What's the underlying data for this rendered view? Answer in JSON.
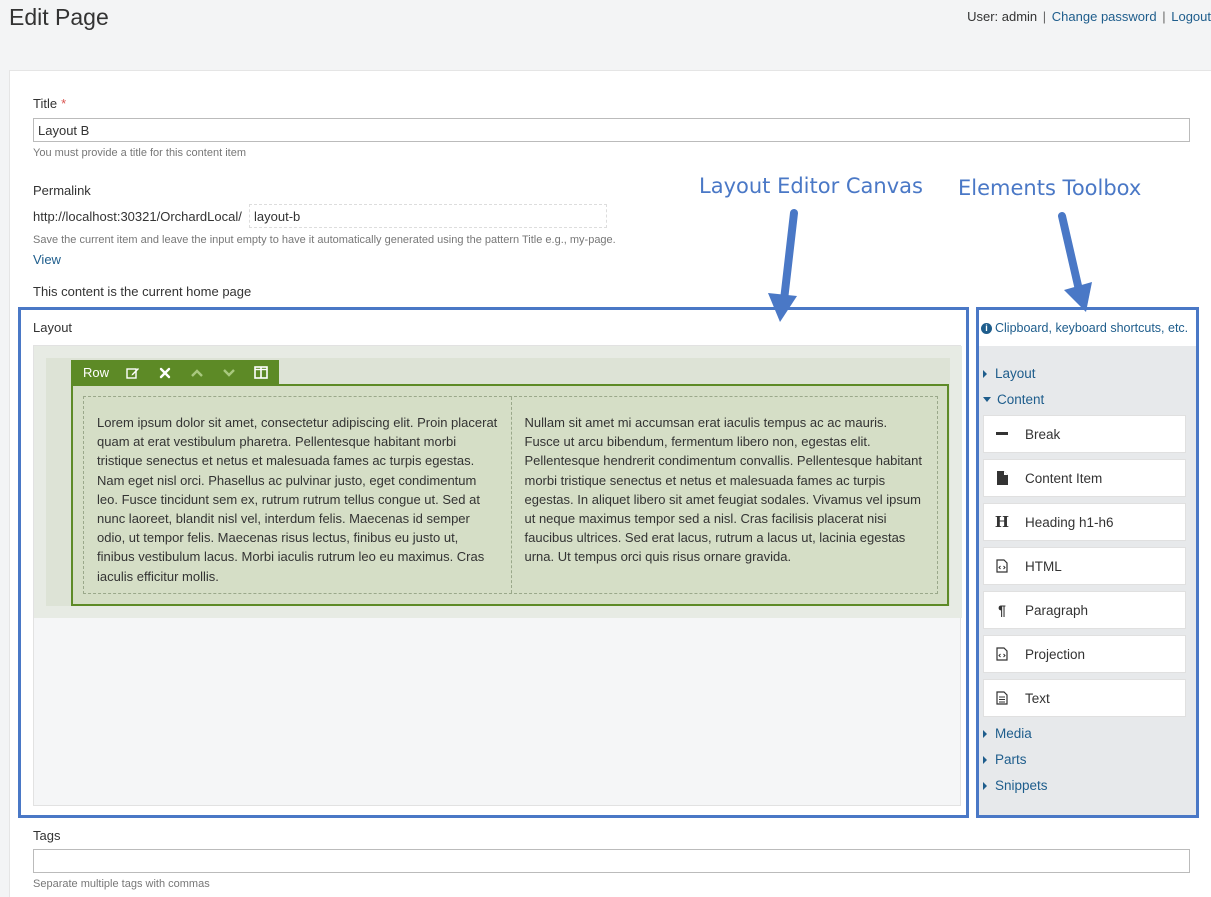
{
  "page": {
    "title": "Edit Page"
  },
  "user_bar": {
    "user_text": "User: admin",
    "sep": "|",
    "change_password": "Change password",
    "logout": "Logout"
  },
  "form": {
    "title_label": "Title",
    "required_mark": "*",
    "title_value": "Layout B",
    "title_hint": "You must provide a title for this content item",
    "permalink_label": "Permalink",
    "permalink_prefix": "http://localhost:30321/OrchardLocal/",
    "slug_value": "layout-b",
    "permalink_hint": "Save the current item and leave the input empty to have it automatically generated using the pattern Title e.g., my-page.",
    "view_link": "View",
    "home_note": "This content is the current home page",
    "layout_label": "Layout",
    "tags_label": "Tags",
    "tags_value": "",
    "tags_hint": "Separate multiple tags with commas"
  },
  "row_toolbar": {
    "label": "Row",
    "icons": [
      "edit-icon",
      "delete-icon",
      "move-up-icon",
      "move-down-icon",
      "split-columns-icon"
    ]
  },
  "columns": [
    "Lorem ipsum dolor sit amet, consectetur adipiscing elit. Proin placerat quam at erat vestibulum pharetra. Pellentesque habitant morbi tristique senectus et netus et malesuada fames ac turpis egestas. Nam eget nisl orci. Phasellus ac pulvinar justo, eget condimentum leo. Fusce tincidunt sem ex, rutrum rutrum tellus congue ut. Sed at nunc laoreet, blandit nisl vel, interdum felis. Maecenas id semper odio, ut tempor felis. Maecenas risus lectus, finibus eu justo ut, finibus vestibulum lacus. Morbi iaculis rutrum leo eu maximus. Cras iaculis efficitur mollis.",
    "Nullam sit amet mi accumsan erat iaculis tempus ac ac mauris. Fusce ut arcu bibendum, fermentum libero non, egestas elit. Pellentesque hendrerit condimentum convallis. Pellentesque habitant morbi tristique senectus et netus et malesuada fames ac turpis egestas. In aliquet libero sit amet feugiat sodales. Vivamus vel ipsum ut neque maximus tempor sed a nisl. Cras facilisis placerat nisi faucibus ultrices. Sed erat lacus, rutrum a lacus ut, lacinia egestas urna. Ut tempus orci quis risus ornare gravida."
  ],
  "toolbox": {
    "header": "Clipboard, keyboard shortcuts, etc.",
    "groups": {
      "layout": "Layout",
      "content": "Content",
      "media": "Media",
      "parts": "Parts",
      "snippets": "Snippets"
    },
    "content_items": [
      {
        "label": "Break",
        "icon": "break-icon"
      },
      {
        "label": "Content Item",
        "icon": "file-icon"
      },
      {
        "label": "Heading h1-h6",
        "icon": "heading-icon"
      },
      {
        "label": "HTML",
        "icon": "html-file-icon"
      },
      {
        "label": "Paragraph",
        "icon": "paragraph-icon"
      },
      {
        "label": "Projection",
        "icon": "projection-file-icon"
      },
      {
        "label": "Text",
        "icon": "text-file-icon"
      }
    ]
  },
  "annotations": {
    "canvas": "Layout Editor Canvas",
    "toolbox": "Elements Toolbox",
    "color": "#4a78c6"
  },
  "colors": {
    "accent_link": "#1e5d8c",
    "row_green": "#5d8a26",
    "required": "#d9534f"
  }
}
